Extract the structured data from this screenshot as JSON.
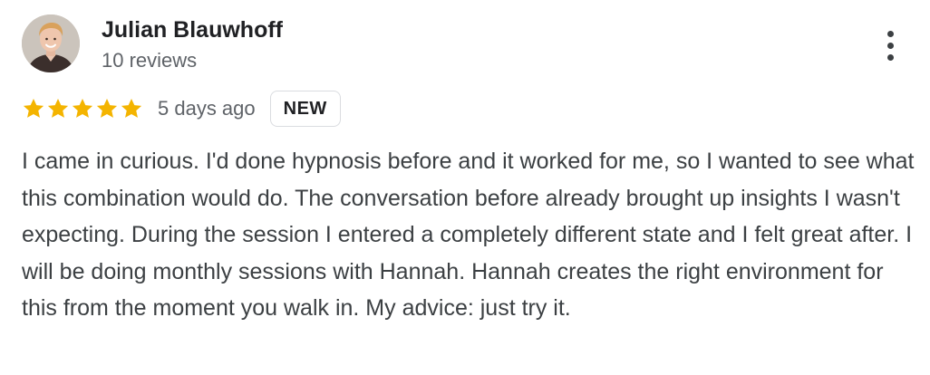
{
  "review": {
    "author": {
      "name": "Julian Blauwhoff",
      "review_count": "10 reviews",
      "avatar_icon": "user-avatar-photo"
    },
    "rating": {
      "stars": 5,
      "max_stars": 5,
      "star_color": "#f4b400"
    },
    "time_ago": "5 days ago",
    "badge": "NEW",
    "text": "I came in curious. I'd done hypnosis before and it worked for me, so I wanted to see what this combination would do. The conversation before already brought up insights I wasn't expecting. During the session I entered a completely different state and I felt great after. I will be doing monthly sessions with Hannah. Hannah creates the right environment for this from the moment you walk in. My advice: just try it.",
    "more_icon": "more-vert-icon"
  }
}
